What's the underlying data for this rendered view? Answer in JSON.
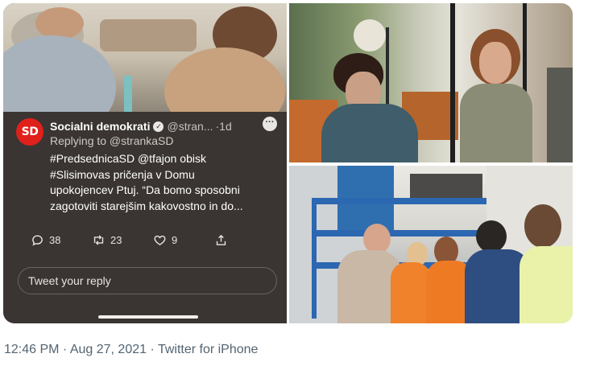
{
  "tweet": {
    "author_name": "Socialni demokrati",
    "author_handle": "@stran...",
    "time_ago": "·1d",
    "avatar_text": "SD",
    "replying_to": "Replying to @strankaSD",
    "body_lines": [
      "#PredsednicaSD @tfajon obisk",
      "#Slisimovas pričenja v Domu",
      "upokojencev Ptuj. “Da bomo sposobni",
      "zagotoviti starejšim kakovostno in do..."
    ],
    "reply_count": "38",
    "retweet_count": "23",
    "like_count": "9",
    "reply_placeholder": "Tweet your reply"
  },
  "footer": {
    "timestamp": "12:46 PM · Aug 27, 2021 · Twitter for iPhone"
  },
  "colors": {
    "avatar_red": "#e0201b",
    "panel_dark": "#3a3532",
    "meta_gray": "#536471"
  },
  "icons": [
    "verified-badge-icon",
    "more-options-icon",
    "reply-icon",
    "retweet-icon",
    "like-icon",
    "share-icon"
  ]
}
